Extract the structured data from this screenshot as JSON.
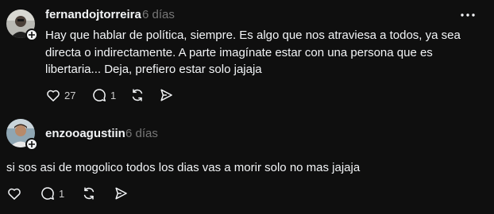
{
  "posts": [
    {
      "username": "fernandojtorreira",
      "time": "6 días",
      "text": "Hay que hablar de política, siempre. Es algo que nos atraviesa a todos, ya sea directa o indirectamente. A parte imagínate estar con una persona que es libertaria... Deja, prefiero estar solo jajaja",
      "likes": "27",
      "replies": "1",
      "icons": {
        "like": "heart-icon",
        "reply": "comment-icon",
        "repost": "repost-icon",
        "share": "send-icon",
        "more": "more-icon",
        "follow": "plus-icon"
      }
    },
    {
      "username": "enzooagustiin",
      "time": "6 días",
      "text": "si sos asi de mogolico todos los dias vas a morir solo no mas jajaja",
      "replies": "1",
      "icons": {
        "like": "heart-icon",
        "reply": "comment-icon",
        "repost": "repost-icon",
        "share": "send-icon",
        "follow": "plus-icon"
      }
    }
  ],
  "colors": {
    "background": "#0f0f0f",
    "text_primary": "#f3f5f7",
    "text_secondary": "#777777",
    "icon": "#cccccc"
  }
}
